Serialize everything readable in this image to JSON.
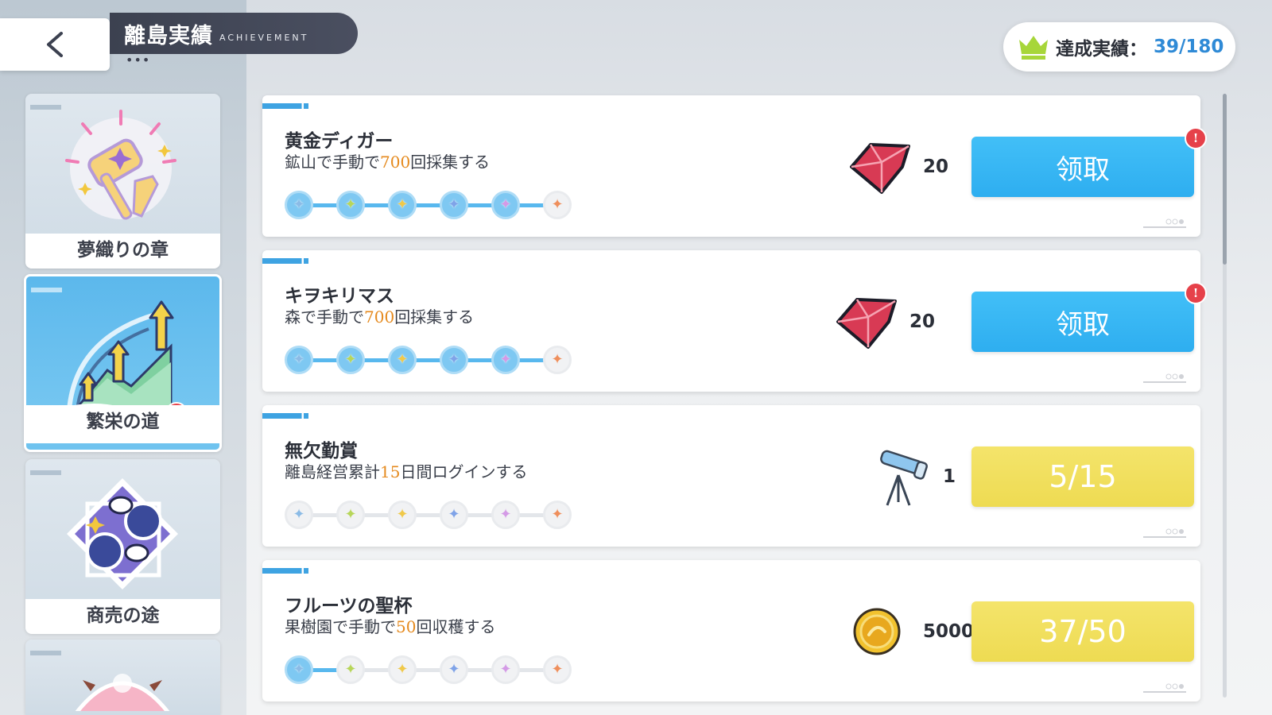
{
  "header": {
    "title": "離島実績",
    "subtitle": "ACHIEVEMENT",
    "dots": "•••",
    "achievement_label": "達成実績：",
    "achievement_value": "39/180"
  },
  "sidebar": {
    "categories": [
      {
        "label": "夢織りの章",
        "icon": "hammer-icon",
        "active": false
      },
      {
        "label": "繁栄の道",
        "icon": "growth-arrows-icon",
        "active": true,
        "alert": "!"
      },
      {
        "label": "商売の途",
        "icon": "fruit-trade-icon",
        "active": false
      },
      {
        "label": "",
        "icon": "pink-character-icon",
        "active": false
      }
    ]
  },
  "achievements": [
    {
      "title": "黄金ディガー",
      "desc_pre": "鉱山で手動で",
      "desc_num": "700",
      "desc_post": "回採集する",
      "stages_done": 5,
      "stages_total": 6,
      "reward_icon": "ruby-icon",
      "reward_count": "20",
      "button": "领取",
      "button_type": "claim",
      "alert": "!"
    },
    {
      "title": "キヲキリマス",
      "desc_pre": "森で手動で",
      "desc_num": "700",
      "desc_post": "回採集する",
      "stages_done": 5,
      "stages_total": 6,
      "reward_icon": "ruby-icon",
      "reward_count": "20",
      "button": "领取",
      "button_type": "claim",
      "alert": "!"
    },
    {
      "title": "無欠勤賞",
      "desc_pre": "離島経営累計",
      "desc_num": "15",
      "desc_post": "日間ログインする",
      "stages_done": 0,
      "stages_total": 6,
      "reward_icon": "telescope-icon",
      "reward_count": "1",
      "button": "5/15",
      "button_type": "progress"
    },
    {
      "title": "フルーツの聖杯",
      "desc_pre": "果樹園で手動で",
      "desc_num": "50",
      "desc_post": "回収穫する",
      "stages_done": 1,
      "stages_total": 6,
      "reward_icon": "gold-coin-icon",
      "reward_count": "5000",
      "button": "37/50",
      "button_type": "progress"
    }
  ],
  "colors": {
    "claim_button": "#33b3f2",
    "progress_button": "#f0dd58",
    "highlight": "#e58a1e",
    "alert": "#e6414a",
    "achievement_value": "#2f8ad6"
  }
}
